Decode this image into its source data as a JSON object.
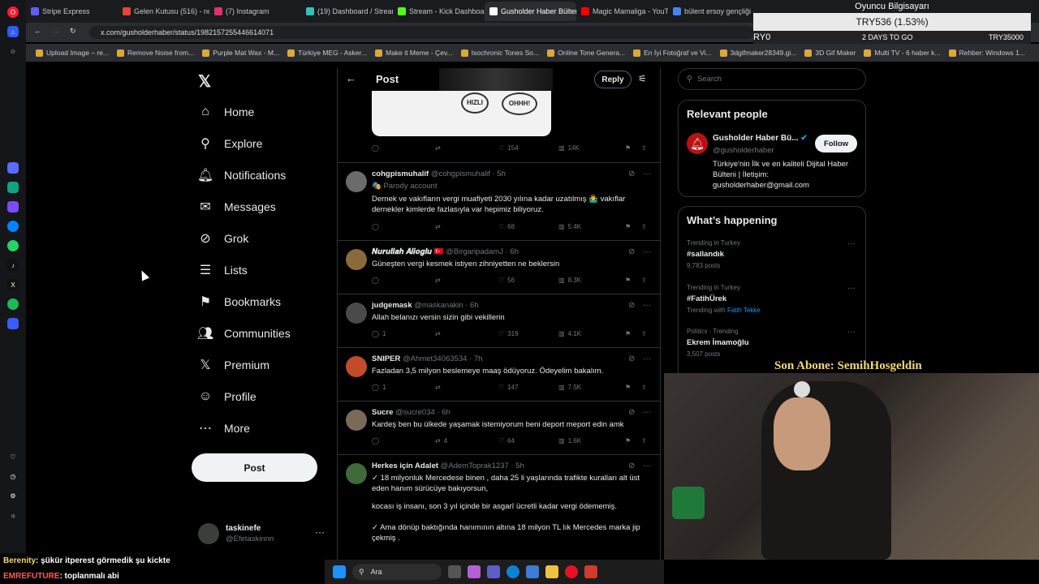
{
  "browser": {
    "tabs": [
      {
        "label": "Stripe Express",
        "color": "#635bff"
      },
      {
        "label": "Gelen Kutusu (516) - nos",
        "color": "#ea4335"
      },
      {
        "label": "(7) Instagram",
        "color": "#e1306c"
      },
      {
        "label": "(19) Dashboard / Streamla",
        "color": "#2ec4b6"
      },
      {
        "label": "Stream - Kick Dashboard",
        "color": "#53fc18"
      },
      {
        "label": "Gusholder Haber Bülteni",
        "color": "#ffffff",
        "active": true
      },
      {
        "label": "Magic Mamaliga - YouTub",
        "color": "#ff0000"
      },
      {
        "label": "bülent ersoy gençliği - Go",
        "color": "#4285f4"
      }
    ],
    "url": "x.com/gusholderhaber/status/1982157255446614071",
    "bookmarks": [
      "Upload Image – re...",
      "Remove Noise from...",
      "Purple Mat Wax - M...",
      "Türkiye MEG - Asker...",
      "Make it Meme - Çev...",
      "Isochronic Tones So...",
      "Online Tone Genera...",
      "En İyi Fotoğraf ve Vi...",
      "3dgifmaker28349.gi...",
      "3D Gif Maker",
      "Multi TV - 6 haber k...",
      "Rehber: Windows 1..."
    ]
  },
  "nav": {
    "items": [
      {
        "label": "Home",
        "icon": "home-icon",
        "glyph": "⌂"
      },
      {
        "label": "Explore",
        "icon": "search-icon",
        "glyph": "⚲"
      },
      {
        "label": "Notifications",
        "icon": "bell-icon",
        "glyph": "🔔︎"
      },
      {
        "label": "Messages",
        "icon": "envelope-icon",
        "glyph": "✉"
      },
      {
        "label": "Grok",
        "icon": "grok-icon",
        "glyph": "⊘"
      },
      {
        "label": "Lists",
        "icon": "list-icon",
        "glyph": "☰"
      },
      {
        "label": "Bookmarks",
        "icon": "bookmark-icon",
        "glyph": "⚑"
      },
      {
        "label": "Communities",
        "icon": "people-icon",
        "glyph": "👥︎"
      },
      {
        "label": "Premium",
        "icon": "x-logo-icon",
        "glyph": "𝕏"
      },
      {
        "label": "Profile",
        "icon": "person-icon",
        "glyph": "☺"
      },
      {
        "label": "More",
        "icon": "more-circle-icon",
        "glyph": "⋯"
      }
    ],
    "post_label": "Post",
    "account": {
      "name": "taskinefe",
      "handle": "@Efetaskinnn"
    }
  },
  "feed": {
    "header_title": "Post",
    "reply_label": "Reply",
    "top_actions": {
      "likes": "154",
      "views": "14K"
    },
    "tweets": [
      {
        "name": "cohgpismuhalif",
        "handle": "@cohgpismuhalif · 5h",
        "sub": "🎭 Parody account",
        "text": "Dernek ve vakıfların vergi muafiyeti 2030 yılına kadar uzatılmış 🤷‍♂️ vakıflar dernekler kimlerde fazlasıyla var hepimiz biliyoruz.",
        "replies": "",
        "retweets": "",
        "likes": "68",
        "views": "5.4K",
        "avcolor": "#6b6b6b"
      },
      {
        "name": "𝑵𝒖𝒓𝒖𝒍𝒍𝒂𝒉 𝑨𝒍𝒊𝒐𝒈𝒍𝒖 🇹🇷",
        "handle": "@BirgaripadamJ · 6h",
        "sub": "",
        "text": "Güneşten vergi kesmek istiyen zihniyetten ne beklersin",
        "replies": "",
        "retweets": "",
        "likes": "56",
        "views": "8.3K",
        "avcolor": "#8a6a3a"
      },
      {
        "name": "judgemask",
        "handle": "@maskanakin · 6h",
        "sub": "",
        "text": "Allah belanızı versin sizin gibi vekillerin",
        "replies": "1",
        "retweets": "",
        "likes": "319",
        "views": "4.1K",
        "avcolor": "#4a4a4a"
      },
      {
        "name": "SNIPER",
        "handle": "@Ahmet34063534 · 7h",
        "sub": "",
        "text": "Fazladan 3,5 milyon beslemeye maaş ödüyoruz. Ödeyelim bakalım.",
        "replies": "1",
        "retweets": "",
        "likes": "147",
        "views": "7.5K",
        "avcolor": "#c24b2a"
      },
      {
        "name": "Sucre",
        "handle": "@sucre034 · 6h",
        "sub": "",
        "text": "Kardeş ben bu ülkede yaşamak istemiyorum beni deport meport edin amk",
        "replies": "",
        "retweets": "4",
        "likes": "64",
        "views": "1.6K",
        "avcolor": "#7a6a5a"
      },
      {
        "name": "Herkes için Adalet",
        "handle": "@AdemToprak1237 · 5h",
        "sub": "",
        "text": "✓ 18 milyonluk Mercedese binen , daha 25 li yaşlarında trafikte kuralları alt üst eden hanım sürücüye bakıyorsun,",
        "text2": "kocası iş insanı, son 3 yıl içinde bir asgarî ücretli kadar vergi ödememiş.",
        "text3": "✓ Ama dönüp baktığında hanımının altına 18 milyon TL lık Mercedes marka jip çekmiş .",
        "avcolor": "#3f6a3a"
      }
    ]
  },
  "right": {
    "search_placeholder": "Search",
    "relevant_title": "Relevant people",
    "relevant": {
      "name": "Gusholder Haber Bü...",
      "handle": "@gusholderhaber",
      "bio": "Türkiye'nin İlk ve en kaliteli Dijital Haber Bülteni | İletişim: gusholderhaber@gmail.com",
      "follow_label": "Follow"
    },
    "happening_title": "What’s happening",
    "trends": [
      {
        "meta": "Trending in Turkey",
        "topic": "#sallandık",
        "count": "9,783 posts",
        "with": ""
      },
      {
        "meta": "Trending in Turkey",
        "topic": "#FatihÜrek",
        "count": "",
        "with": "Trending with ",
        "with_link": "Fatih Tekke"
      },
      {
        "meta": "Politics · Trending",
        "topic": "Ekrem İmamoğlu",
        "count": "3,507 posts",
        "with": ""
      }
    ]
  },
  "overlay": {
    "title": "Oyuncu Bilgisayarı",
    "price": "TRY536 (1.53%)",
    "left": "RY0",
    "days": "2 DAYS TO GO",
    "right": "TRY35000",
    "son_abone": "Son Abone: SemihHosgeldin"
  },
  "chat": [
    {
      "user": "Berenity",
      "msg": ": şükür itperest görmedik şu kickte",
      "color": "#f5d76e"
    },
    {
      "user": "EMREFUTURE",
      "msg": ": toplanmalı abi",
      "color": "#ff5a5a"
    }
  ],
  "taskbar": {
    "search_label": "Ara"
  }
}
